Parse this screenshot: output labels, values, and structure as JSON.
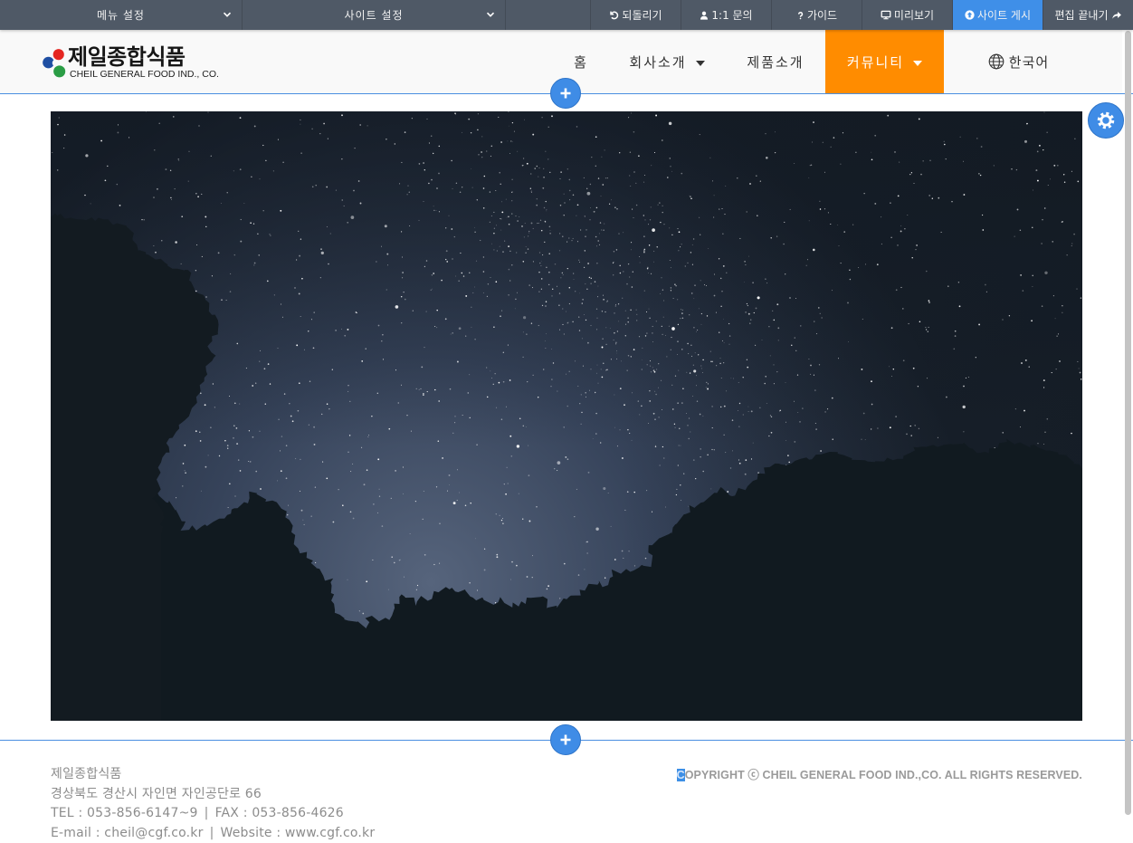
{
  "toolbar": {
    "dropdowns": [
      {
        "label": "메뉴 설정",
        "icon": "chevron-down-icon"
      },
      {
        "label": "사이트 설정",
        "icon": "chevron-down-icon"
      }
    ],
    "buttons": [
      {
        "label": "되돌리기",
        "icon": "undo-icon"
      },
      {
        "label": "1:1 문의",
        "icon": "user-icon"
      },
      {
        "label": "가이드",
        "icon": "question-icon"
      },
      {
        "label": "미리보기",
        "icon": "monitor-icon"
      },
      {
        "label": "사이트 게시",
        "icon": "upload-circle-icon",
        "highlighted": true
      },
      {
        "label": "편집 끝내기",
        "icon": "share-arrow-icon"
      }
    ]
  },
  "header": {
    "logo": {
      "name_ko": "제일종합식품",
      "name_en": "CHEIL GENERAL FOOD IND., CO.",
      "icon": "logo-mark"
    },
    "nav": [
      {
        "label": "홈"
      },
      {
        "label": "회사소개",
        "dropdown": true
      },
      {
        "label": "제품소개"
      },
      {
        "label": "커뮤니티",
        "dropdown": true,
        "active": true
      }
    ],
    "language": {
      "label": "한국어",
      "icon": "globe-icon"
    }
  },
  "editor": {
    "add_section_icon": "plus-icon",
    "section_settings_icon": "gear-icon"
  },
  "footer": {
    "company": "제일종합식품",
    "address": "경상북도 경산시 자인면 자인공단로 66",
    "tel": "TEL : 053-856-6147~9",
    "fax": "FAX : 053-856-4626",
    "email": "E-mail : cheil@cgf.co.kr",
    "website": "Website : www.cgf.co.kr",
    "separator": "|",
    "copyright": "COPYRIGHT ⓒ CHEIL GENERAL FOOD IND.,CO. ALL RIGHTS RESERVED."
  },
  "colors": {
    "toolbar_bg": "#4f5966",
    "publish_bg": "#3f8fe8",
    "editor_blue": "#4a8fe1",
    "nav_active_bg": "#ff8c00",
    "header_bg": "#f9f9f9",
    "footer_text": "#8c8c8c",
    "logo_red": "#e52621",
    "logo_blue": "#1f4fa3",
    "logo_green": "#2a9d45"
  }
}
